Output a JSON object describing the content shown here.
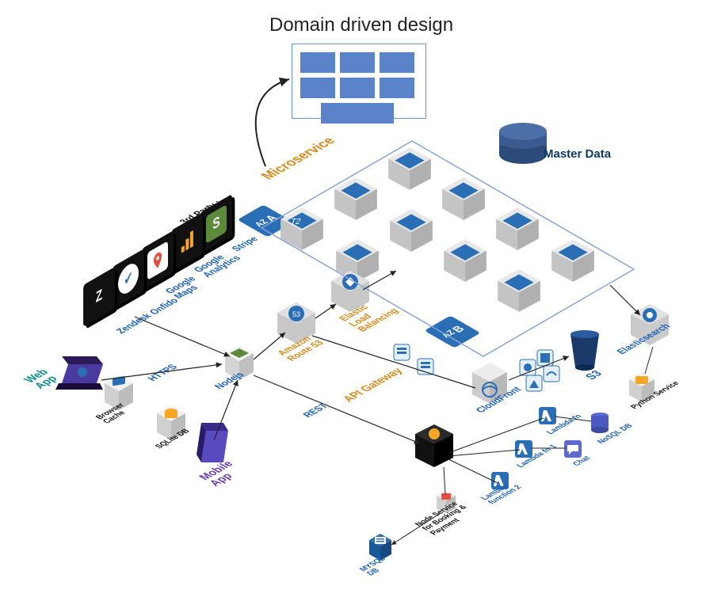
{
  "header": {
    "title": "Domain driven design",
    "master_data": "Master Data"
  },
  "regions": {
    "microservice": "Microservice",
    "third_party": "3rd Party :",
    "api_gateway": "API Gateway"
  },
  "az": {
    "a_prefix": "AZ",
    "a": "A",
    "b_prefix": "AZ",
    "b": "B"
  },
  "clients": {
    "web_app": "Web App",
    "mobile_app": "Mobile App",
    "browser_cache": "Browser Cache",
    "sqlite": "SQLite DB"
  },
  "protocols": {
    "https": "HTTPS",
    "rest": "REST"
  },
  "aws": {
    "nodejs": "Nodejs",
    "route53": "Amazon Route 53",
    "elb": "Elastic Load Balancing",
    "cloudfront": "CloudFront",
    "s3": "S3",
    "elasticsearch": "Elasticsearch",
    "lambda_fn": "Lambda fn",
    "lambda_fn1": "Lambda fn 1",
    "lambda_fn2": "Lambda function 2",
    "chat": "Chat",
    "nosql": "NoSQL DB",
    "python_service": "Python Service",
    "mysql": "MYSQL DB",
    "node_booking": "Node Service for Booking & Payment"
  },
  "third_party": {
    "stripe": "Stripe",
    "ga": "Google Analytics",
    "gmaps": "Google Maps",
    "onfido": "Onfido",
    "zendesk": "Zendesk"
  },
  "microservice_instance_label": "T2"
}
